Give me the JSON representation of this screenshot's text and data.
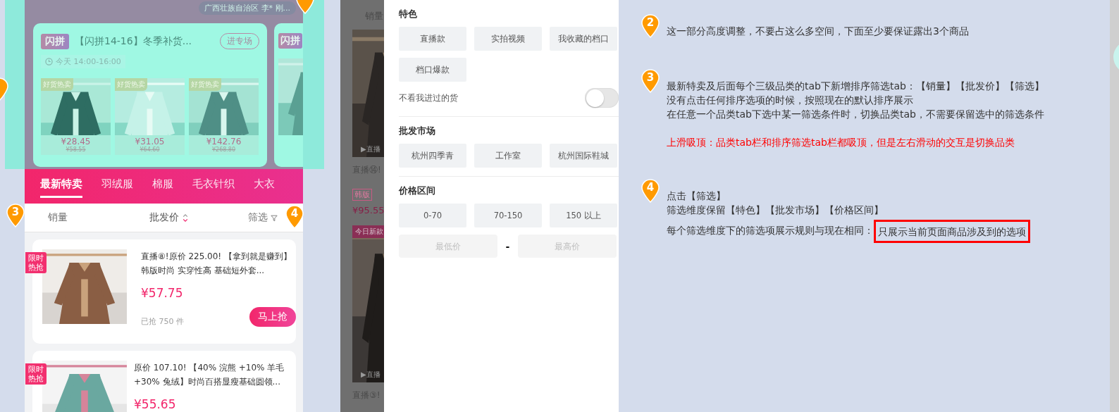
{
  "location_badge": "广西壮族自治区 李* 刚...",
  "flash_cards": [
    {
      "tag": "闪拼",
      "title": "【闪拼14-16】冬季补货...",
      "button": "进专场",
      "time": "今天 14:00-16:00",
      "items": [
        {
          "tag": "好货热卖",
          "price": "¥28.45",
          "original_price": "¥58.55"
        },
        {
          "tag": "好货热卖",
          "price": "¥31.05",
          "original_price": "¥64.60"
        },
        {
          "tag": "好货热卖",
          "price": "¥142.76",
          "original_price": "¥268.80"
        }
      ]
    },
    {
      "tag": "闪拼"
    }
  ],
  "category_tabs": [
    {
      "label": "最新特卖",
      "selected": true
    },
    {
      "label": "羽绒服",
      "selected": false
    },
    {
      "label": "棉服",
      "selected": false
    },
    {
      "label": "毛衣针织",
      "selected": false
    },
    {
      "label": "大衣",
      "selected": false
    }
  ],
  "sort_tabs": [
    {
      "label": "销量",
      "kind": "plain"
    },
    {
      "label": "批发价",
      "kind": "sort"
    },
    {
      "label": "筛选",
      "kind": "filter"
    }
  ],
  "phone_pins": [
    {
      "number": "3"
    },
    {
      "number": "4"
    }
  ],
  "products": [
    {
      "badge": "限时热抢",
      "title": "直播⑧!原价 225.00! 【拿到就是赚到】韩版时尚 实穿性高 基础短外套...",
      "price": "¥57.75",
      "sold": "已抢 750 件",
      "button": "马上抢"
    },
    {
      "badge": "限时热抢",
      "title": "原价 107.10! 【40% 浣熊 +10% 羊毛 +30% 兔绒】时尚百搭显瘦基础圆领...",
      "price": "¥55.65"
    }
  ],
  "background_list": {
    "sort_label": "销量",
    "items": [
      {
        "live_label": "▶直播",
        "title": "直播⑭!",
        "tag": "韩版",
        "price": "¥95.55"
      },
      {
        "badge": "今日新款",
        "live_label": "▶直播",
        "title": "直播③!"
      }
    ]
  },
  "filter_panel": {
    "sections": [
      {
        "title": "特色",
        "options": [
          "直播款",
          "实拍视频",
          "我收藏的档口",
          "档口爆款"
        ],
        "toggle": {
          "label": "不看我进过的货",
          "on": false
        }
      },
      {
        "title": "批发市场",
        "options": [
          "杭州四季青",
          "工作室",
          "杭州国际鞋城"
        ]
      },
      {
        "title": "价格区间",
        "options": [
          "0-70",
          "70-150",
          "150 以上"
        ],
        "price_range": {
          "min_placeholder": "最低价",
          "separator": "-",
          "max_placeholder": "最高价"
        }
      }
    ]
  },
  "notes": [
    {
      "number": "2",
      "lines": [
        {
          "kind": "normal",
          "text": "这一部分高度调整，不要占这么多空间，下面至少要保证露出3个商品"
        }
      ]
    },
    {
      "number": "3",
      "lines": [
        {
          "kind": "normal",
          "text": "最新特卖及后面每个三级品类的tab下新增排序筛选tab：【销量】【批发价】【筛选】"
        },
        {
          "kind": "normal",
          "text": "没有点击任何排序选项的时候，按照现在的默认排序展示"
        },
        {
          "kind": "normal",
          "text": "在任意一个品类tab下选中某一筛选条件时，切换品类tab，不需要保留选中的筛选条件"
        },
        {
          "kind": "warning",
          "text": "上滑吸顶：品类tab栏和排序筛选tab栏都吸顶，但是左右滑动的交互是切换品类"
        }
      ]
    },
    {
      "number": "4",
      "lines": [
        {
          "kind": "normal",
          "text": "点击【筛选】"
        },
        {
          "kind": "normal",
          "text": "筛选维度保留【特色】【批发市场】【价格区间】"
        },
        {
          "kind": "boxed",
          "text": "每个筛选维度下的筛选项展示规则与现在相同：",
          "highlight": "只展示当前页面商品涉及到的选项"
        }
      ]
    }
  ]
}
